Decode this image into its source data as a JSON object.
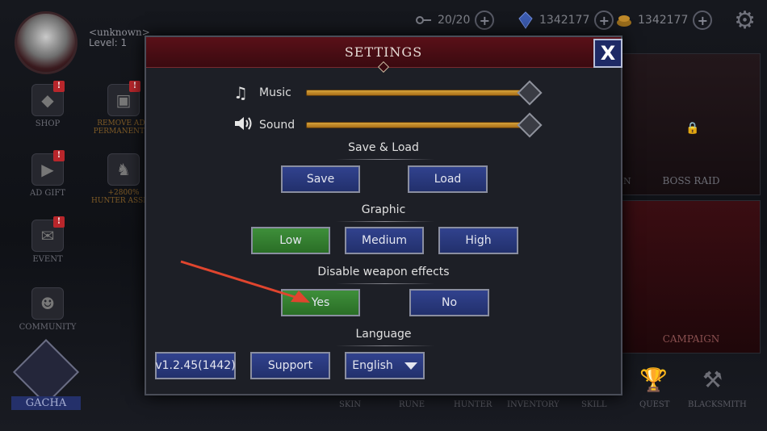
{
  "player": {
    "name": "<unknown>",
    "level": "Level: 1"
  },
  "resources": [
    {
      "icon": "key-icon",
      "value": "20/20"
    },
    {
      "icon": "crystal-icon",
      "value": "1342177"
    },
    {
      "icon": "gold-icon",
      "value": "1342177"
    }
  ],
  "sidebar": [
    {
      "label": "SHOP",
      "icon": "diamond-icon"
    },
    {
      "label": "REMOVE ADS PERMANENTLY",
      "icon": "chest-icon"
    },
    {
      "label": "AD GIFT",
      "icon": "video-icon"
    },
    {
      "label": "HUNTER ASSIST",
      "icon": "hunter-icon",
      "extra": "+2800%"
    },
    {
      "label": "EVENT",
      "icon": "gift-icon"
    },
    {
      "label": "COMMUNITY",
      "icon": "community-icon"
    }
  ],
  "gacha": {
    "label": "GACHA"
  },
  "right_panels": {
    "boss_raid": "BOSS RAID",
    "campaign": "CAMPAIGN",
    "partial": "N"
  },
  "bottom_nav": [
    "SKIN",
    "RUNE",
    "HUNTER",
    "INVENTORY",
    "SKILL",
    "QUEST",
    "BLACKSMITH"
  ],
  "dialog": {
    "title": "SETTINGS",
    "close_label": "X",
    "music": {
      "label": "Music",
      "level": 1.0
    },
    "sound": {
      "label": "Sound",
      "level": 1.0
    },
    "save_load": {
      "title": "Save & Load",
      "save": "Save",
      "load": "Load"
    },
    "graphic": {
      "title": "Graphic",
      "low": "Low",
      "medium": "Medium",
      "high": "High",
      "selected": "Low"
    },
    "weapon_effects": {
      "title": "Disable weapon effects",
      "yes": "Yes",
      "no": "No",
      "selected": "Yes"
    },
    "language": {
      "title": "Language",
      "version": "v1.2.45(1442)",
      "support": "Support",
      "selected": "English"
    }
  },
  "colors": {
    "accent_red": "#5a1018",
    "button_blue": "#31428e",
    "button_green": "#3e8f3a",
    "slider_gold": "#d6a23a",
    "arrow": "#e0452e"
  }
}
